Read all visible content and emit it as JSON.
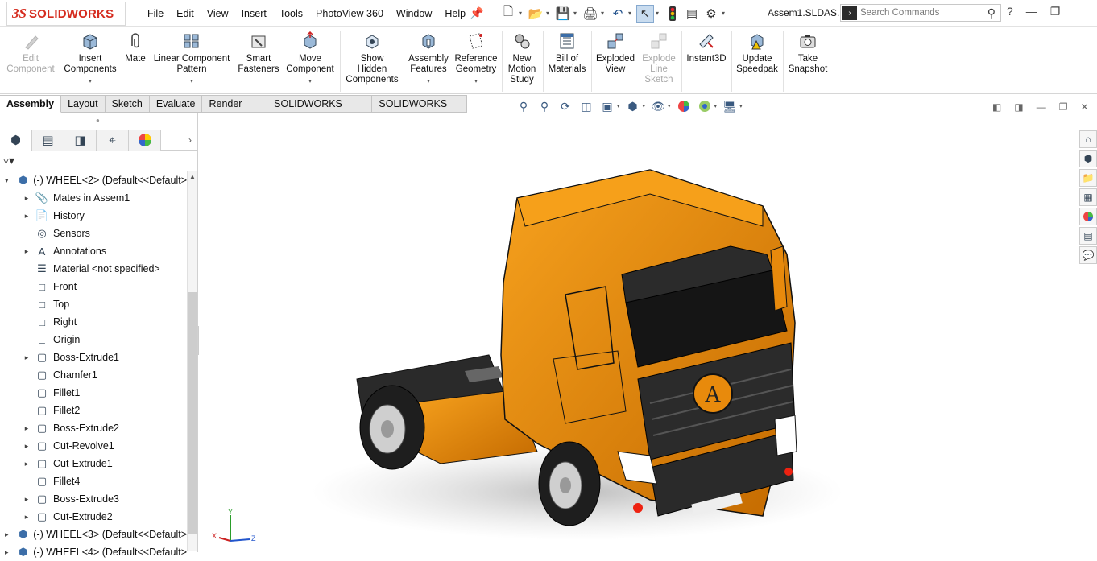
{
  "app": {
    "brand_ds": "3S",
    "brand_name": "SOLIDWORKS",
    "document_title": "Assem1.SLDAS..."
  },
  "menu": [
    "File",
    "Edit",
    "View",
    "Insert",
    "Tools",
    "PhotoView 360",
    "Window",
    "Help"
  ],
  "search": {
    "placeholder": "Search Commands"
  },
  "ribbon": {
    "edit_component": [
      "Edit",
      "Component"
    ],
    "insert_components": [
      "Insert",
      "Components"
    ],
    "mate": [
      "Mate"
    ],
    "linear_pattern": [
      "Linear Component",
      "Pattern"
    ],
    "smart_fasteners": [
      "Smart",
      "Fasteners"
    ],
    "move_component": [
      "Move",
      "Component"
    ],
    "show_hidden": [
      "Show",
      "Hidden",
      "Components"
    ],
    "assembly_features": [
      "Assembly",
      "Features"
    ],
    "reference_geometry": [
      "Reference",
      "Geometry"
    ],
    "new_motion_study": [
      "New",
      "Motion",
      "Study"
    ],
    "bill_of_materials": [
      "Bill of",
      "Materials"
    ],
    "exploded_view": [
      "Exploded",
      "View"
    ],
    "explode_line_sketch": [
      "Explode",
      "Line",
      "Sketch"
    ],
    "instant3d": [
      "Instant3D"
    ],
    "update_speedpak": [
      "Update",
      "Speedpak"
    ],
    "take_snapshot": [
      "Take",
      "Snapshot"
    ]
  },
  "tabs": [
    "Assembly",
    "Layout",
    "Sketch",
    "Evaluate",
    "Render Tools",
    "SOLIDWORKS Add-Ins",
    "SOLIDWORKS MBD"
  ],
  "tree": [
    {
      "label": "(-) WHEEL<2> (Default<<Default>",
      "exp": "▾",
      "level": 0
    },
    {
      "label": "Mates in Assem1",
      "exp": "▸",
      "level": 1
    },
    {
      "label": "History",
      "exp": "▸",
      "level": 1
    },
    {
      "label": "Sensors",
      "exp": "",
      "level": 1
    },
    {
      "label": "Annotations",
      "exp": "▸",
      "level": 1
    },
    {
      "label": "Material <not specified>",
      "exp": "",
      "level": 1
    },
    {
      "label": "Front",
      "exp": "",
      "level": 1
    },
    {
      "label": "Top",
      "exp": "",
      "level": 1
    },
    {
      "label": "Right",
      "exp": "",
      "level": 1
    },
    {
      "label": "Origin",
      "exp": "",
      "level": 1
    },
    {
      "label": "Boss-Extrude1",
      "exp": "▸",
      "level": 1
    },
    {
      "label": "Chamfer1",
      "exp": "",
      "level": 1
    },
    {
      "label": "Fillet1",
      "exp": "",
      "level": 1
    },
    {
      "label": "Fillet2",
      "exp": "",
      "level": 1
    },
    {
      "label": "Boss-Extrude2",
      "exp": "▸",
      "level": 1
    },
    {
      "label": "Cut-Revolve1",
      "exp": "▸",
      "level": 1
    },
    {
      "label": "Cut-Extrude1",
      "exp": "▸",
      "level": 1
    },
    {
      "label": "Fillet4",
      "exp": "",
      "level": 1
    },
    {
      "label": "Boss-Extrude3",
      "exp": "▸",
      "level": 1
    },
    {
      "label": "Cut-Extrude2",
      "exp": "▸",
      "level": 1
    },
    {
      "label": "(-) WHEEL<3> (Default<<Default>",
      "exp": "▸",
      "level": 0
    },
    {
      "label": "(-) WHEEL<4> (Default<<Default>",
      "exp": "▸",
      "level": 0
    }
  ],
  "triad": {
    "x": "X",
    "y": "Y",
    "z": "Z"
  },
  "model": {
    "emblem": "A",
    "cab_color": "#e88a0c",
    "dark_color": "#222222"
  }
}
